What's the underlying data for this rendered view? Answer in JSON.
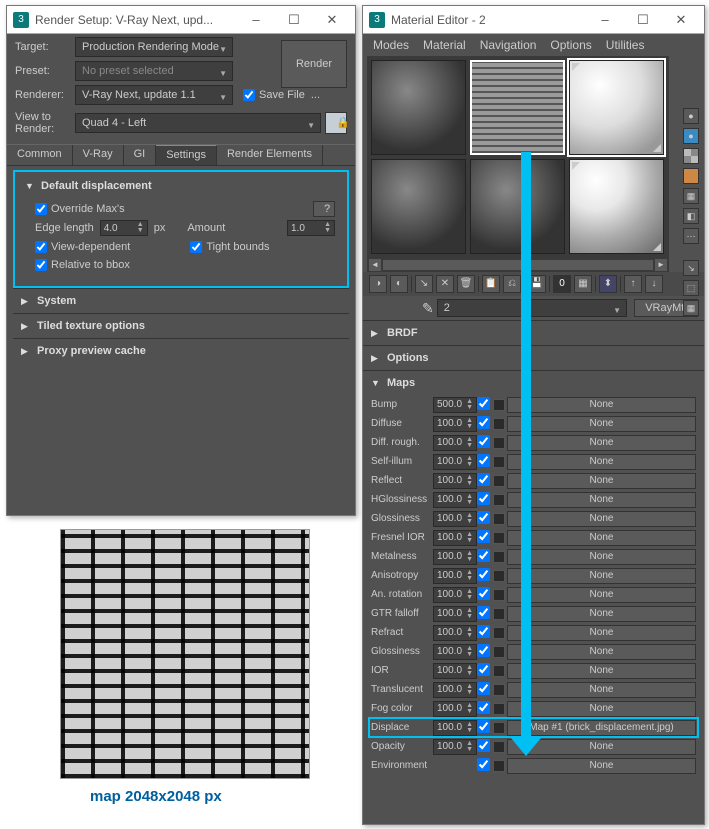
{
  "render_window": {
    "title": "Render Setup: V-Ray Next, upd...",
    "target_label": "Target:",
    "target_value": "Production Rendering Mode",
    "preset_label": "Preset:",
    "preset_value": "No preset selected",
    "renderer_label": "Renderer:",
    "renderer_value": "V-Ray Next, update 1.1",
    "save_file_label": "Save File",
    "ellipsis": "...",
    "render_btn": "Render",
    "view_label_1": "View to",
    "view_label_2": "Render:",
    "view_value": "Quad 4 - Left",
    "lock_icon": "🔒",
    "tabs": [
      "Common",
      "V-Ray",
      "GI",
      "Settings",
      "Render Elements"
    ],
    "active_tab": 3,
    "default_disp": {
      "title": "Default displacement",
      "override": "Override Max's",
      "edge_length": "Edge length",
      "edge_val": "4.0",
      "px": "px",
      "amount": "Amount",
      "amount_val": "1.0",
      "view_dep": "View-dependent",
      "tight": "Tight bounds",
      "relative": "Relative to bbox",
      "help": "?"
    },
    "sections": [
      "System",
      "Tiled texture options",
      "Proxy preview cache"
    ]
  },
  "brick_caption": "map 2048x2048 px",
  "material_window": {
    "title": "Material Editor - 2",
    "menu": [
      "Modes",
      "Material",
      "Navigation",
      "Options",
      "Utilities"
    ],
    "picker_name": "2",
    "mat_type": "VRayMtl",
    "rollouts": [
      "BRDF",
      "Options",
      "Maps"
    ],
    "maps": [
      {
        "name": "Bump",
        "val": "500.0",
        "btn": "None"
      },
      {
        "name": "Diffuse",
        "val": "100.0",
        "btn": "None"
      },
      {
        "name": "Diff. rough.",
        "val": "100.0",
        "btn": "None"
      },
      {
        "name": "Self-illum",
        "val": "100.0",
        "btn": "None"
      },
      {
        "name": "Reflect",
        "val": "100.0",
        "btn": "None"
      },
      {
        "name": "HGlossiness",
        "val": "100.0",
        "btn": "None"
      },
      {
        "name": "Glossiness",
        "val": "100.0",
        "btn": "None"
      },
      {
        "name": "Fresnel IOR",
        "val": "100.0",
        "btn": "None"
      },
      {
        "name": "Metalness",
        "val": "100.0",
        "btn": "None"
      },
      {
        "name": "Anisotropy",
        "val": "100.0",
        "btn": "None"
      },
      {
        "name": "An. rotation",
        "val": "100.0",
        "btn": "None"
      },
      {
        "name": "GTR falloff",
        "val": "100.0",
        "btn": "None"
      },
      {
        "name": "Refract",
        "val": "100.0",
        "btn": "None"
      },
      {
        "name": "Glossiness",
        "val": "100.0",
        "btn": "None"
      },
      {
        "name": "IOR",
        "val": "100.0",
        "btn": "None"
      },
      {
        "name": "Translucent",
        "val": "100.0",
        "btn": "None"
      },
      {
        "name": "Fog color",
        "val": "100.0",
        "btn": "None"
      },
      {
        "name": "Displace",
        "val": "100.0",
        "btn": "Map #1 (brick_displacement.jpg)"
      },
      {
        "name": "Opacity",
        "val": "100.0",
        "btn": "None"
      },
      {
        "name": "Environment",
        "val": "",
        "btn": "None"
      }
    ],
    "displace_row_index": 17
  }
}
